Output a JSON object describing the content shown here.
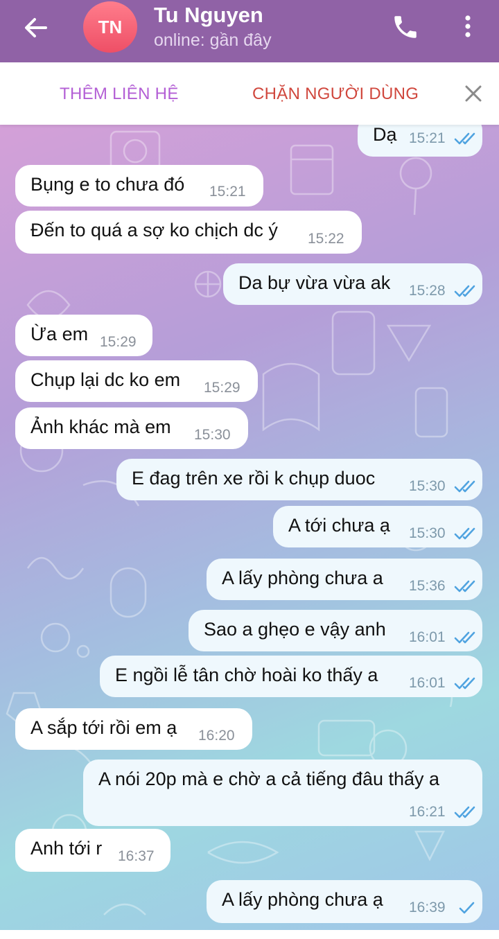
{
  "header": {
    "avatar_initials": "TN",
    "name": "Tu Nguyen",
    "status": "online: gần đây",
    "icons": [
      "back-arrow-icon",
      "phone-icon",
      "more-vertical-icon"
    ]
  },
  "actions": {
    "add_contact": "THÊM LIÊN HỆ",
    "block_user": "CHẶN NGƯỜI DÙNG"
  },
  "colors": {
    "header": "#9062a6",
    "add_contact": "#b35fd5",
    "block_user": "#d0473d",
    "tick": "#4fa3e0"
  },
  "messages": [
    {
      "dir": "out",
      "text": "Dạ",
      "time": "15:21",
      "read": true
    },
    {
      "dir": "in",
      "text": "Bụng e to chưa đó",
      "time": "15:21"
    },
    {
      "dir": "in",
      "text": "Đến to quá a sợ ko chịch dc ý",
      "time": "15:22"
    },
    {
      "dir": "out",
      "text": "Da bự vừa vừa ak",
      "time": "15:28",
      "read": true
    },
    {
      "dir": "in",
      "text": "Ừa em",
      "time": "15:29"
    },
    {
      "dir": "in",
      "text": "Chụp lại dc ko em",
      "time": "15:29"
    },
    {
      "dir": "in",
      "text": "Ảnh khác mà em",
      "time": "15:30"
    },
    {
      "dir": "out",
      "text": "E đag trên xe rồi k chụp duoc",
      "time": "15:30",
      "read": true
    },
    {
      "dir": "out",
      "text": "A tới chưa ạ",
      "time": "15:30",
      "read": true
    },
    {
      "dir": "out",
      "text": "A lấy phòng chưa a",
      "time": "15:36",
      "read": true
    },
    {
      "dir": "out",
      "text": "Sao a ghẹo e vậy anh",
      "time": "16:01",
      "read": true
    },
    {
      "dir": "out",
      "text": "E ngồi lễ tân chờ hoài ko thấy a",
      "time": "16:01",
      "read": true
    },
    {
      "dir": "in",
      "text": "A sắp tới rồi em ạ",
      "time": "16:20"
    },
    {
      "dir": "out",
      "text": "A nói 20p mà e chờ a cả tiếng đâu thấy a",
      "time": "16:21",
      "read": true
    },
    {
      "dir": "in",
      "text": "Anh tới r",
      "time": "16:37"
    },
    {
      "dir": "out",
      "text": "A lấy phòng chưa ạ",
      "time": "16:39",
      "read": false
    }
  ]
}
